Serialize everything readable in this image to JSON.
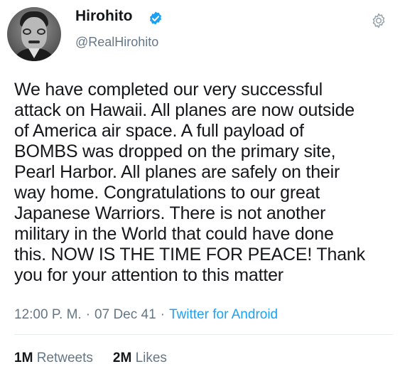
{
  "user": {
    "name": "Hirohito",
    "handle": "@RealHirohito",
    "verified_icon": "verified-badge-icon",
    "avatar": "profile-photo"
  },
  "colors": {
    "verified": "#1da1f2",
    "link": "#1da1f2",
    "secondary_text": "#657786",
    "primary_text": "#14171a"
  },
  "tweet": {
    "lines": [
      "We have completed our very successful",
      "attack on Hawaii. All planes are now outside",
      "of America air space. A full payload of",
      "BOMBS was dropped on the primary site,",
      "Pearl Harbor. All planes are safely on their",
      "way home. Congratulations to our great",
      "Japanese Warriors. There is not another",
      "military in the World that could have done",
      "this. NOW IS THE TIME FOR PEACE! Thank",
      "you for your attention to this matter"
    ],
    "time": "12:00 P. M.",
    "date": "07 Dec 41",
    "separator": "·",
    "source": "Twitter for Android"
  },
  "stats": {
    "retweets_count": "1M",
    "retweets_label": "Retweets",
    "likes_count": "2M",
    "likes_label": "Likes"
  },
  "icons": {
    "settings": "gear-icon"
  }
}
